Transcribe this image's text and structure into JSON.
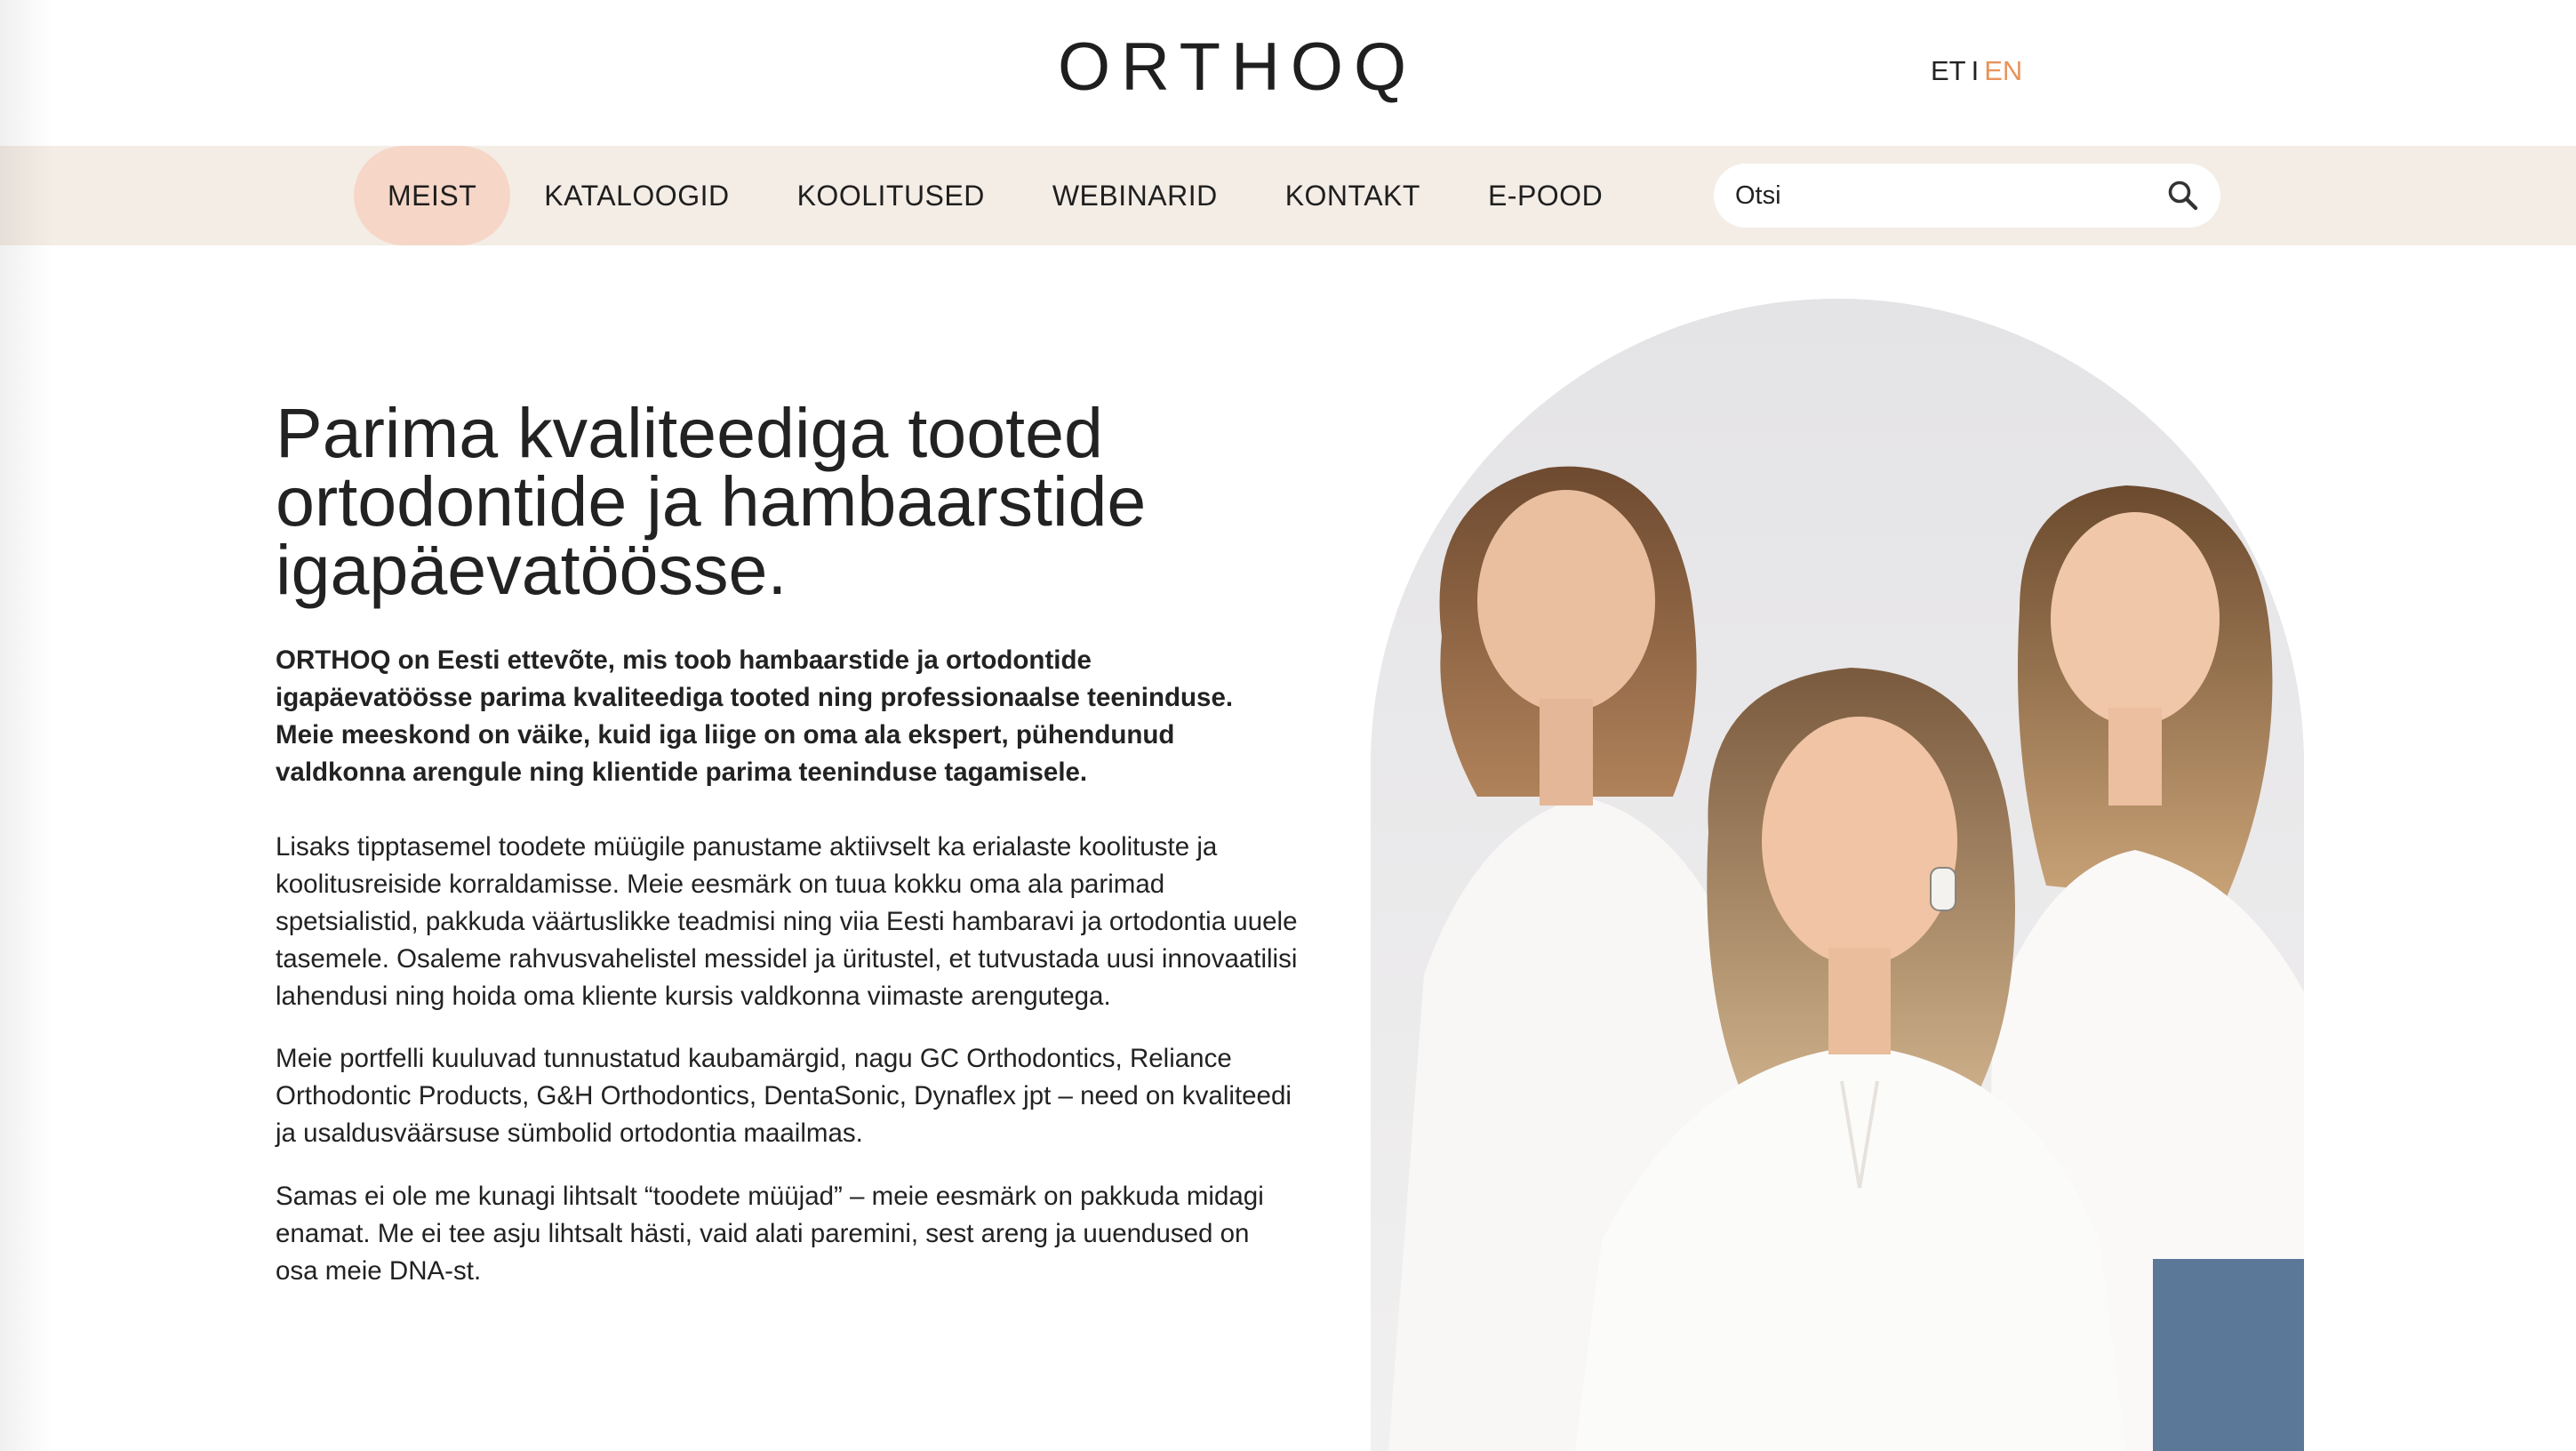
{
  "header": {
    "logo": "ORTHOQ",
    "lang": {
      "et": "ET",
      "separator": "I",
      "en": "EN"
    }
  },
  "nav": {
    "items": [
      {
        "label": "MEIST",
        "active": true
      },
      {
        "label": "KATALOOGID",
        "active": false
      },
      {
        "label": "KOOLITUSED",
        "active": false
      },
      {
        "label": "WEBINARID",
        "active": false
      },
      {
        "label": "KONTAKT",
        "active": false
      },
      {
        "label": "E-POOD",
        "active": false
      }
    ],
    "search": {
      "value": "",
      "placeholder": "Otsi",
      "icon": "search-icon"
    }
  },
  "main": {
    "headline": "Parima kvaliteediga tooted ortodontide ja hambaarstide igapäevatöösse.",
    "lead": "ORTHOQ on Eesti ettevõte, mis toob hambaarstide ja ortodontide igapäevatöösse parima kvaliteediga tooted ning professionaalse teeninduse. Meie meeskond on väike, kuid iga liige on oma ala ekspert, pühendunud valdkonna arengule ning klientide parima teeninduse tagamisele.",
    "paragraphs": [
      "Lisaks tipptasemel toodete müügile panustame aktiivselt ka erialaste koolituste ja koolitusreiside korraldamisse. Meie eesmärk on tuua kokku oma ala parimad spetsialistid, pakkuda väärtuslikke teadmisi ning viia Eesti hambaravi ja ortodontia uuele tasemele. Osaleme rahvusvahelistel messidel ja üritustel, et tutvustada uusi innovaatilisi lahendusi ning hoida oma kliente kursis valdkonna viimaste arengutega.",
      "Meie portfelli kuuluvad tunnustatud kaubamärgid, nagu GC Orthodontics, Reliance Orthodontic Products, G&H Orthodontics, DentaSonic, Dynaflex jpt – need on kvaliteedi ja usaldusväärsuse sümbolid ortodontia maailmas.",
      "Samas ei ole me kunagi lihtsalt “toodete müüjad” – meie eesmärk on pakkuda midagi enamat. Me ei tee asju lihtsalt hästi, vaid alati paremini, sest areng ja uuendused on osa meie DNA-st."
    ]
  },
  "colors": {
    "nav_bg": "#f4ede6",
    "active_pill": "#f6d6c7",
    "accent_en": "#e8935b",
    "text": "#222222"
  }
}
